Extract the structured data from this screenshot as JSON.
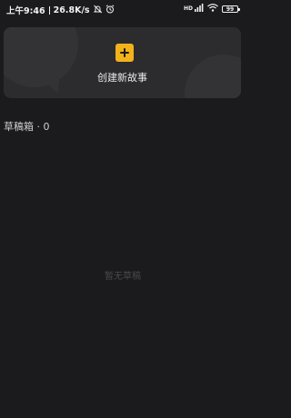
{
  "status_bar": {
    "time": "上午9:46",
    "speed": "26.8K/s",
    "signal": "HD",
    "battery": "99"
  },
  "new_story": {
    "label": "创建新故事"
  },
  "drafts": {
    "title": "草稿箱 · 0",
    "empty_text": "暂无草稿"
  },
  "colors": {
    "accent": "#f2b21a",
    "background": "#1b1b1d",
    "card": "#2c2c2f"
  }
}
